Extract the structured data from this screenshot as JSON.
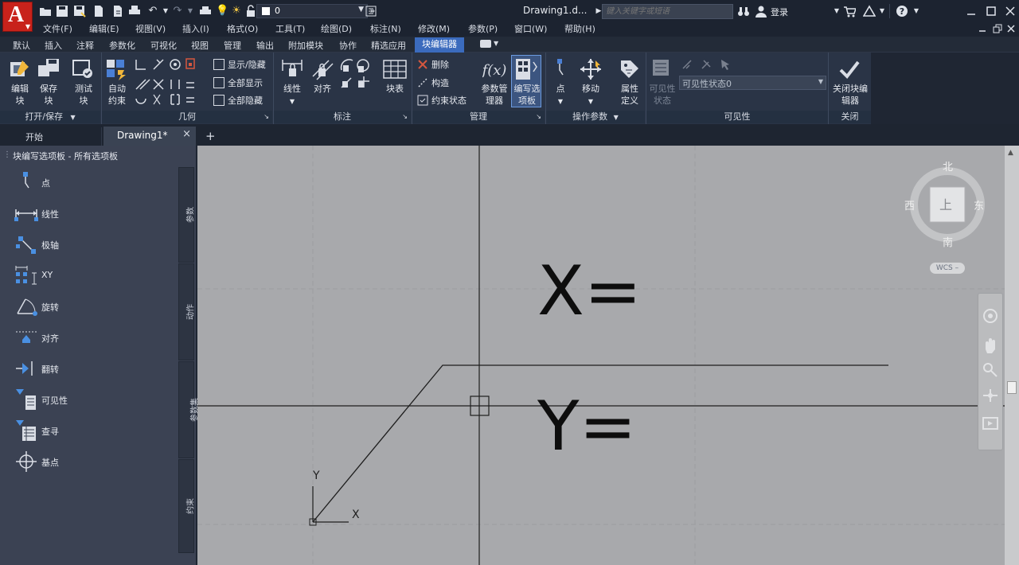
{
  "app": {
    "logo_letter": "A",
    "document_title": "Drawing1.d...",
    "search_placeholder": "键入关键字或短语",
    "login_label": "登录",
    "layer_name": "0"
  },
  "menu": [
    "文件(F)",
    "编辑(E)",
    "视图(V)",
    "插入(I)",
    "格式(O)",
    "工具(T)",
    "绘图(D)",
    "标注(N)",
    "修改(M)",
    "参数(P)",
    "窗口(W)",
    "帮助(H)"
  ],
  "ribbon_tabs": [
    "默认",
    "插入",
    "注释",
    "参数化",
    "可视化",
    "视图",
    "管理",
    "输出",
    "附加模块",
    "协作",
    "精选应用"
  ],
  "ribbon_active_tab": "块编辑器",
  "ribbon": {
    "open_save": {
      "edit_block": "编辑块",
      "save_block": "保存块",
      "test_block": "测试块",
      "footer": "打开/保存"
    },
    "geometry": {
      "auto_constrain": "自动约束",
      "show_hide": "显示/隐藏",
      "show_all": "全部显示",
      "hide_all": "全部隐藏",
      "footer": "几何"
    },
    "dimension": {
      "linear": "线性",
      "aligned": "对齐",
      "footer": "标注"
    },
    "manage": {
      "block_table": "块表",
      "delete": "删除",
      "construct": "构造",
      "constraint_status": "约束状态",
      "param_manager": "参数管理器",
      "authoring_palettes": "编写选项板",
      "footer": "管理"
    },
    "action_params": {
      "point": "点",
      "move": "移动",
      "attr_def": "属性定义",
      "footer": "操作参数"
    },
    "visibility": {
      "vis_state_btn": "可见性状态",
      "vis_state_value": "可见性状态0",
      "footer": "可见性"
    },
    "close": {
      "close_editor": "关闭块编辑器",
      "footer": "关闭"
    }
  },
  "doc_tabs": {
    "start": "开始",
    "drawing": "Drawing1*",
    "close": "×",
    "plus": "+"
  },
  "palette": {
    "title": "块编写选项板 - 所有选项板",
    "items": [
      "点",
      "线性",
      "极轴",
      "XY",
      "旋转",
      "对齐",
      "翻转",
      "可见性",
      "查寻",
      "基点"
    ],
    "side_tabs": [
      "参数",
      "动作",
      "参数集",
      "约束"
    ]
  },
  "canvas": {
    "x_label": "X=",
    "y_label": "Y=",
    "ucs_x": "X",
    "ucs_y": "Y"
  },
  "viewcube": {
    "north": "北",
    "south": "南",
    "east": "东",
    "west": "西",
    "face": "上",
    "wcs": "WCS"
  }
}
